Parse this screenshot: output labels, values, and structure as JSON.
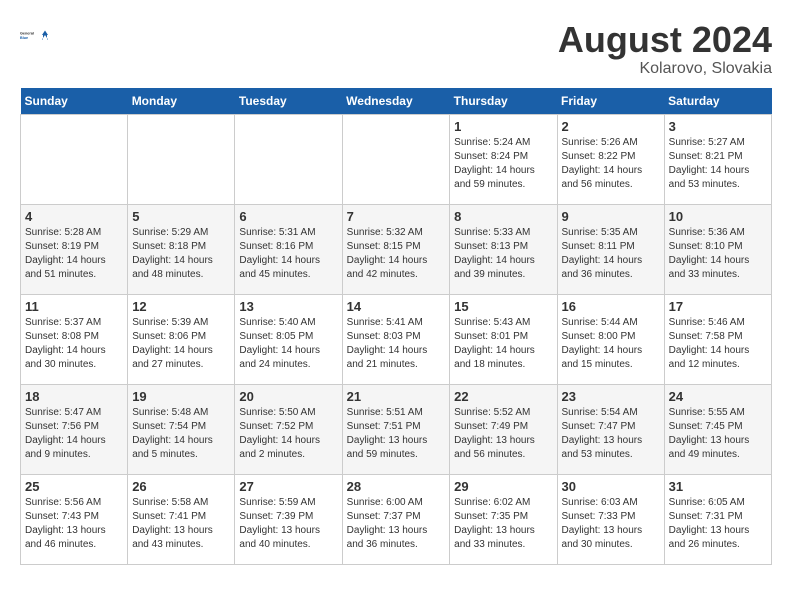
{
  "header": {
    "logo_general": "General",
    "logo_blue": "Blue",
    "month_year": "August 2024",
    "location": "Kolarovo, Slovakia"
  },
  "days_of_week": [
    "Sunday",
    "Monday",
    "Tuesday",
    "Wednesday",
    "Thursday",
    "Friday",
    "Saturday"
  ],
  "weeks": [
    [
      {
        "day": "",
        "info": ""
      },
      {
        "day": "",
        "info": ""
      },
      {
        "day": "",
        "info": ""
      },
      {
        "day": "",
        "info": ""
      },
      {
        "day": "1",
        "info": "Sunrise: 5:24 AM\nSunset: 8:24 PM\nDaylight: 14 hours and 59 minutes."
      },
      {
        "day": "2",
        "info": "Sunrise: 5:26 AM\nSunset: 8:22 PM\nDaylight: 14 hours and 56 minutes."
      },
      {
        "day": "3",
        "info": "Sunrise: 5:27 AM\nSunset: 8:21 PM\nDaylight: 14 hours and 53 minutes."
      }
    ],
    [
      {
        "day": "4",
        "info": "Sunrise: 5:28 AM\nSunset: 8:19 PM\nDaylight: 14 hours and 51 minutes."
      },
      {
        "day": "5",
        "info": "Sunrise: 5:29 AM\nSunset: 8:18 PM\nDaylight: 14 hours and 48 minutes."
      },
      {
        "day": "6",
        "info": "Sunrise: 5:31 AM\nSunset: 8:16 PM\nDaylight: 14 hours and 45 minutes."
      },
      {
        "day": "7",
        "info": "Sunrise: 5:32 AM\nSunset: 8:15 PM\nDaylight: 14 hours and 42 minutes."
      },
      {
        "day": "8",
        "info": "Sunrise: 5:33 AM\nSunset: 8:13 PM\nDaylight: 14 hours and 39 minutes."
      },
      {
        "day": "9",
        "info": "Sunrise: 5:35 AM\nSunset: 8:11 PM\nDaylight: 14 hours and 36 minutes."
      },
      {
        "day": "10",
        "info": "Sunrise: 5:36 AM\nSunset: 8:10 PM\nDaylight: 14 hours and 33 minutes."
      }
    ],
    [
      {
        "day": "11",
        "info": "Sunrise: 5:37 AM\nSunset: 8:08 PM\nDaylight: 14 hours and 30 minutes."
      },
      {
        "day": "12",
        "info": "Sunrise: 5:39 AM\nSunset: 8:06 PM\nDaylight: 14 hours and 27 minutes."
      },
      {
        "day": "13",
        "info": "Sunrise: 5:40 AM\nSunset: 8:05 PM\nDaylight: 14 hours and 24 minutes."
      },
      {
        "day": "14",
        "info": "Sunrise: 5:41 AM\nSunset: 8:03 PM\nDaylight: 14 hours and 21 minutes."
      },
      {
        "day": "15",
        "info": "Sunrise: 5:43 AM\nSunset: 8:01 PM\nDaylight: 14 hours and 18 minutes."
      },
      {
        "day": "16",
        "info": "Sunrise: 5:44 AM\nSunset: 8:00 PM\nDaylight: 14 hours and 15 minutes."
      },
      {
        "day": "17",
        "info": "Sunrise: 5:46 AM\nSunset: 7:58 PM\nDaylight: 14 hours and 12 minutes."
      }
    ],
    [
      {
        "day": "18",
        "info": "Sunrise: 5:47 AM\nSunset: 7:56 PM\nDaylight: 14 hours and 9 minutes."
      },
      {
        "day": "19",
        "info": "Sunrise: 5:48 AM\nSunset: 7:54 PM\nDaylight: 14 hours and 5 minutes."
      },
      {
        "day": "20",
        "info": "Sunrise: 5:50 AM\nSunset: 7:52 PM\nDaylight: 14 hours and 2 minutes."
      },
      {
        "day": "21",
        "info": "Sunrise: 5:51 AM\nSunset: 7:51 PM\nDaylight: 13 hours and 59 minutes."
      },
      {
        "day": "22",
        "info": "Sunrise: 5:52 AM\nSunset: 7:49 PM\nDaylight: 13 hours and 56 minutes."
      },
      {
        "day": "23",
        "info": "Sunrise: 5:54 AM\nSunset: 7:47 PM\nDaylight: 13 hours and 53 minutes."
      },
      {
        "day": "24",
        "info": "Sunrise: 5:55 AM\nSunset: 7:45 PM\nDaylight: 13 hours and 49 minutes."
      }
    ],
    [
      {
        "day": "25",
        "info": "Sunrise: 5:56 AM\nSunset: 7:43 PM\nDaylight: 13 hours and 46 minutes."
      },
      {
        "day": "26",
        "info": "Sunrise: 5:58 AM\nSunset: 7:41 PM\nDaylight: 13 hours and 43 minutes."
      },
      {
        "day": "27",
        "info": "Sunrise: 5:59 AM\nSunset: 7:39 PM\nDaylight: 13 hours and 40 minutes."
      },
      {
        "day": "28",
        "info": "Sunrise: 6:00 AM\nSunset: 7:37 PM\nDaylight: 13 hours and 36 minutes."
      },
      {
        "day": "29",
        "info": "Sunrise: 6:02 AM\nSunset: 7:35 PM\nDaylight: 13 hours and 33 minutes."
      },
      {
        "day": "30",
        "info": "Sunrise: 6:03 AM\nSunset: 7:33 PM\nDaylight: 13 hours and 30 minutes."
      },
      {
        "day": "31",
        "info": "Sunrise: 6:05 AM\nSunset: 7:31 PM\nDaylight: 13 hours and 26 minutes."
      }
    ]
  ]
}
